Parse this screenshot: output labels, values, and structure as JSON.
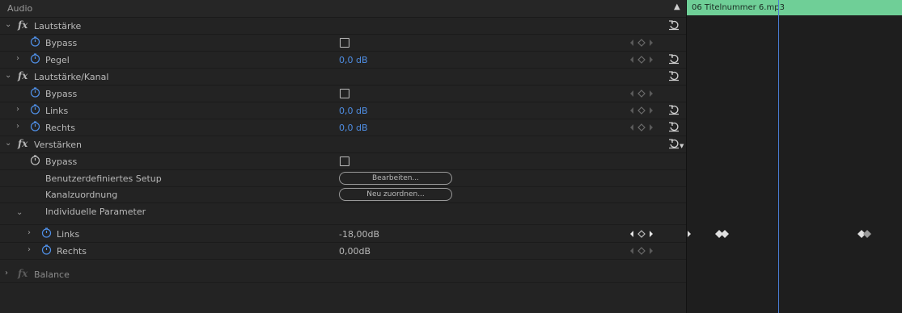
{
  "panel": {
    "title": "Audio"
  },
  "clip": {
    "name": "06 Titelnummer 6.mp3",
    "color": "#6fcf97"
  },
  "colors": {
    "accent_value": "#4f8fe6",
    "playhead": "#4a7fd8"
  },
  "effects": {
    "lautstaerke": {
      "name": "Lautstärke",
      "bypass": "Bypass",
      "pegel_label": "Pegel",
      "pegel_value": "0,0 dB"
    },
    "kanal": {
      "name": "Lautstärke/Kanal",
      "bypass": "Bypass",
      "links_label": "Links",
      "links_value": "0,0 dB",
      "rechts_label": "Rechts",
      "rechts_value": "0,0 dB"
    },
    "verstaerken": {
      "name": "Verstärken",
      "bypass": "Bypass",
      "setup_label": "Benutzerdefiniertes Setup",
      "setup_button": "Bearbeiten...",
      "zuordnung_label": "Kanalzuordnung",
      "zuordnung_button": "Neu zuordnen...",
      "params_label": "Individuelle Parameter",
      "links_label": "Links",
      "links_value": "-18,00dB",
      "rechts_label": "Rechts",
      "rechts_value": "0,00dB"
    },
    "balance": {
      "name": "Balance"
    }
  }
}
